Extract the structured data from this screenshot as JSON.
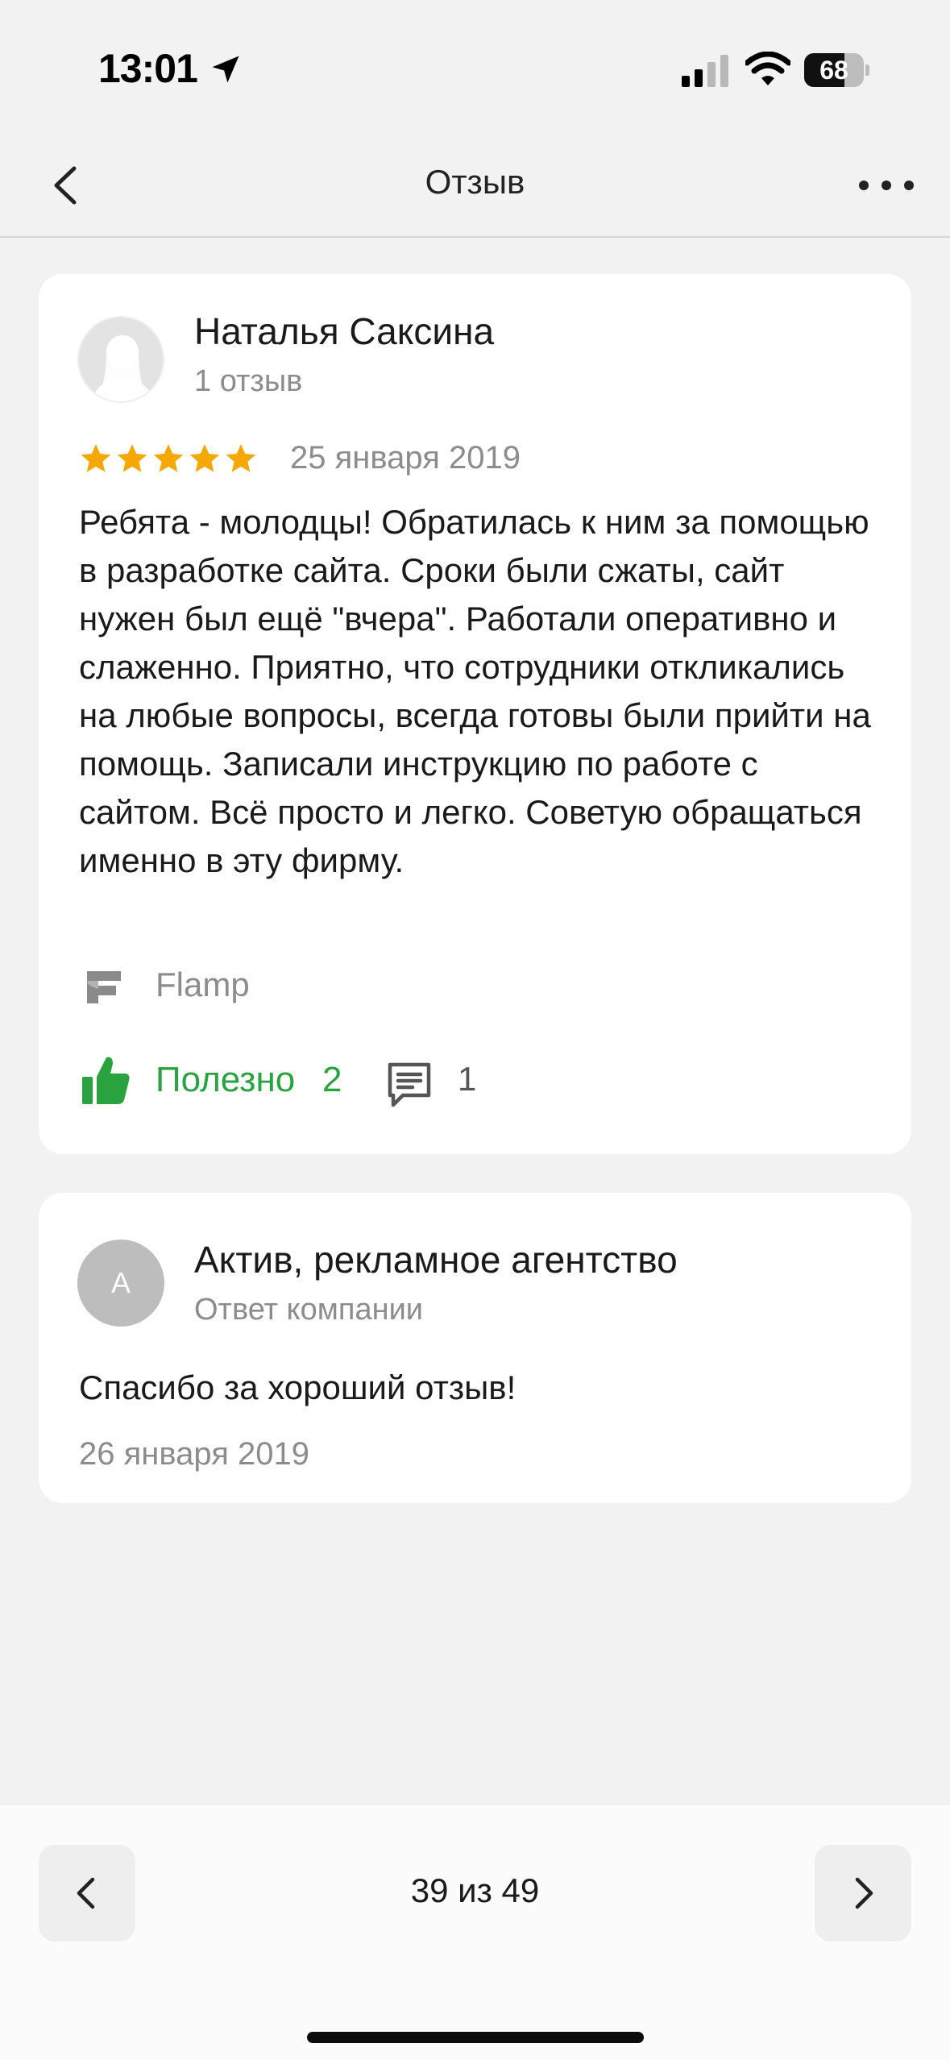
{
  "status_bar": {
    "time": "13:01",
    "battery": "68",
    "battery_level": 0.68
  },
  "nav": {
    "title": "Отзыв"
  },
  "review": {
    "author": "Наталья Саксина",
    "author_meta": "1 отзыв",
    "rating": 5,
    "date": "25 января 2019",
    "text": "Ребята - молодцы! Обратилась к ним за помощью в разработке сайта. Сроки были сжаты, сайт нужен был ещё \"вчера\". Работали оперативно и слаженно. Приятно, что сотрудники откликались на любые вопросы, всегда готовы были прийти на помощь. Записали инструкцию по работе с сайтом. Всё просто и легко. Советую обращаться именно в эту фирму.",
    "source": "Flamp",
    "useful_label": "Полезно",
    "useful_count": "2",
    "comments_count": "1"
  },
  "reply": {
    "avatar_letter": "А",
    "company": "Актив, рекламное агентство",
    "meta": "Ответ компании",
    "text": "Спасибо за хороший отзыв!",
    "date": "26 января 2019"
  },
  "pager": {
    "text": "39 из 49"
  },
  "colors": {
    "accent_green": "#29a33f",
    "star": "#f5a800",
    "secondary_text": "#8c8c8c"
  }
}
